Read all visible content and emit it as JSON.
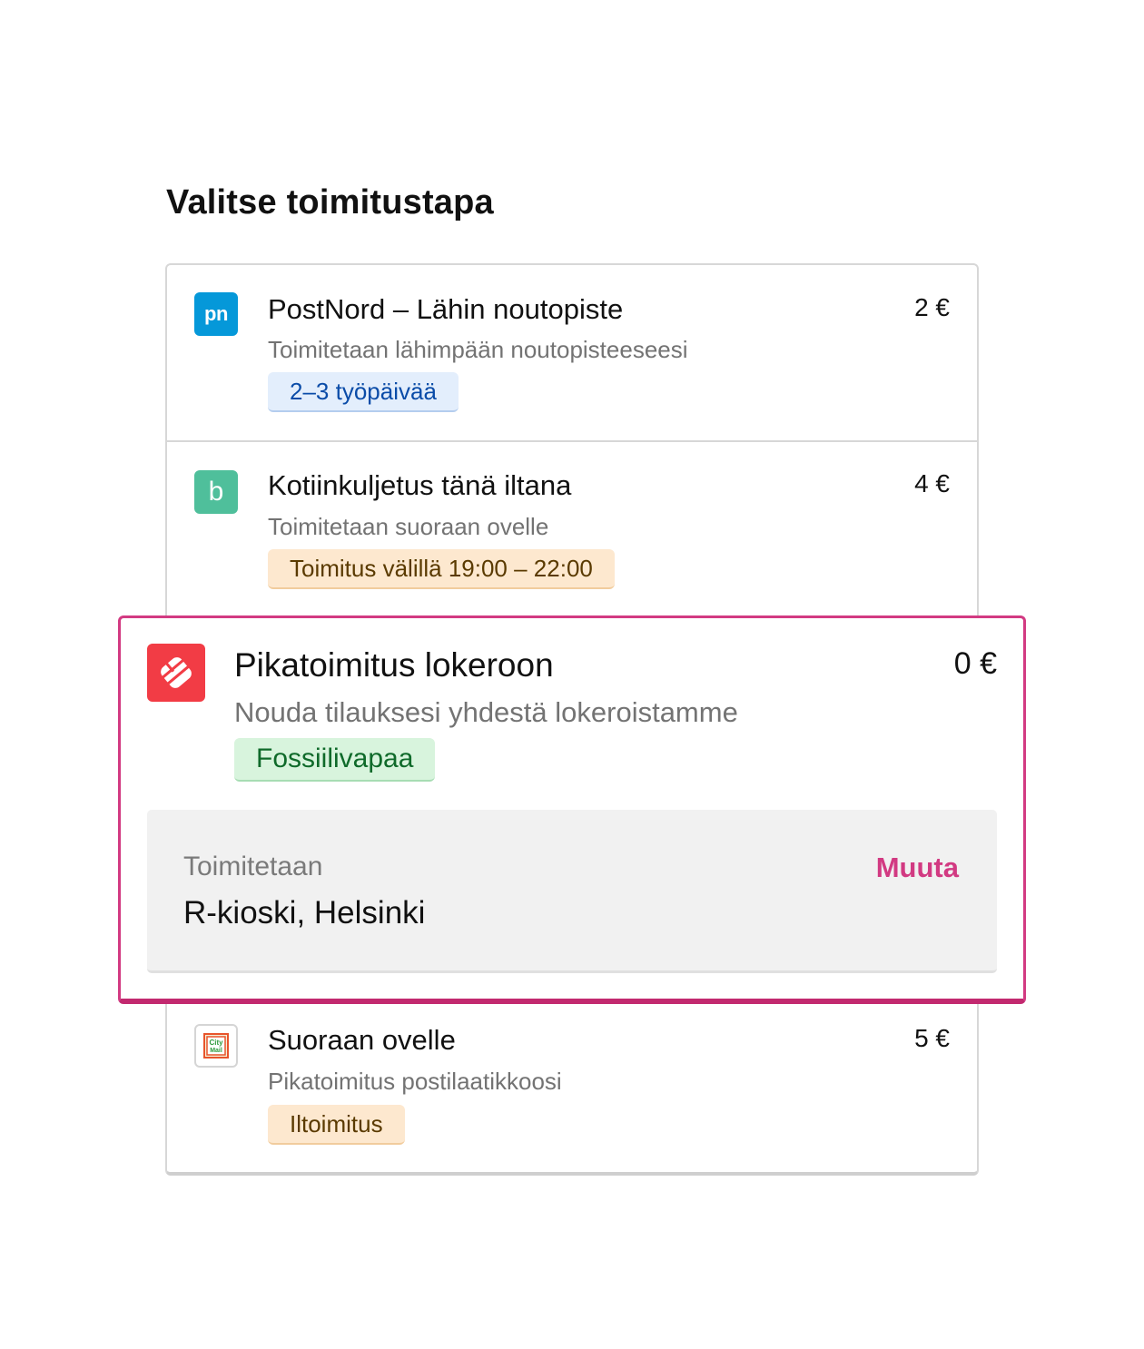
{
  "page": {
    "title": "Valitse toimitustapa"
  },
  "options": [
    {
      "logo": "pn",
      "logo_icon": "postnord-logo-icon",
      "title": "PostNord – Lähin noutopiste",
      "description": "Toimitetaan lähimpään noutopisteeseesi",
      "price": "2 €",
      "badge": "2–3 työpäivää",
      "badge_color": "#e3eefc"
    },
    {
      "logo": "b",
      "logo_icon": "budbee-logo-icon",
      "title": "Kotiinkuljetus tänä iltana",
      "description": "Toimitetaan suoraan ovelle",
      "price": "4 €",
      "badge": "Toimitus välillä 19:00 – 22:00",
      "badge_color": "#fde8cf"
    },
    {
      "logo_icon": "pikatoimitus-logo-icon",
      "title": "Pikatoimitus lokeroon",
      "description": "Nouda tilauksesi yhdestä lokeroistamme",
      "price": "0 €",
      "badge": "Fossiilivapaa",
      "badge_color": "#d8f4dd",
      "selected": true,
      "delivery": {
        "label": "Toimitetaan",
        "location": "R-kioski, Helsinki",
        "change_label": "Muuta"
      }
    },
    {
      "logo": "City Mail",
      "logo_icon": "citymail-logo-icon",
      "title": "Suoraan ovelle",
      "description": "Pikatoimitus postilaatikkoosi",
      "price": "5 €",
      "badge": "Iltoimitus",
      "badge_color": "#fde8cf"
    }
  ],
  "colors": {
    "accent": "#d23a82",
    "postnord": "#0598d9",
    "budbee": "#4fbf9b",
    "pikatoimitus": "#f23c45"
  }
}
